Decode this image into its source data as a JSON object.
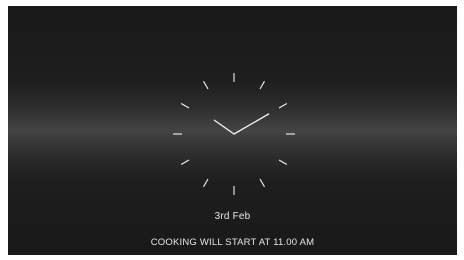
{
  "clock": {
    "hour": 10,
    "minute": 10,
    "color": "#f2f2f2"
  },
  "date_label": "3rd Feb",
  "status_text": "COOKING WILL START AT 11.00 AM",
  "colors": {
    "background": "#1b1b1b",
    "text": "#e6e6e6"
  }
}
